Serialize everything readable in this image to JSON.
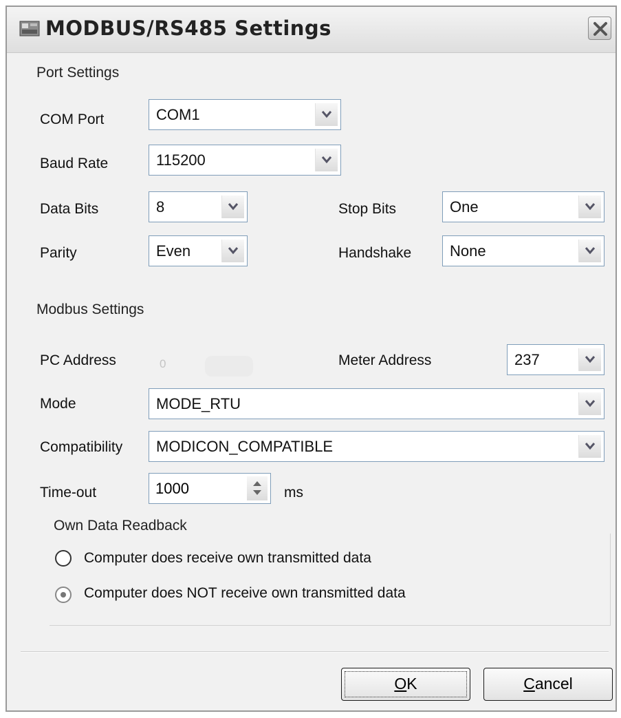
{
  "window": {
    "title": "MODBUS/RS485 Settings"
  },
  "port_settings": {
    "heading": "Port Settings",
    "com_port": {
      "label": "COM Port",
      "value": "COM1"
    },
    "baud_rate": {
      "label": "Baud Rate",
      "value": "115200"
    },
    "data_bits": {
      "label": "Data Bits",
      "value": "8"
    },
    "stop_bits": {
      "label": "Stop Bits",
      "value": "One"
    },
    "parity": {
      "label": "Parity",
      "value": "Even"
    },
    "handshake": {
      "label": "Handshake",
      "value": "None"
    }
  },
  "modbus_settings": {
    "heading": "Modbus Settings",
    "pc_address": {
      "label": "PC Address",
      "value": "0"
    },
    "meter_address": {
      "label": "Meter Address",
      "value": "237"
    },
    "mode": {
      "label": "Mode",
      "value": "MODE_RTU"
    },
    "compatibility": {
      "label": "Compatibility",
      "value": "MODICON_COMPATIBLE"
    },
    "timeout": {
      "label": "Time-out",
      "value": "1000",
      "unit": "ms"
    }
  },
  "readback": {
    "heading": "Own Data Readback",
    "options": [
      {
        "label": "Computer does receive own transmitted data",
        "checked": false
      },
      {
        "label": "Computer does NOT receive own transmitted data",
        "checked": true
      }
    ]
  },
  "buttons": {
    "ok": {
      "mnemonic": "O",
      "rest": "K"
    },
    "cancel": {
      "mnemonic": "C",
      "rest": "ancel"
    }
  }
}
